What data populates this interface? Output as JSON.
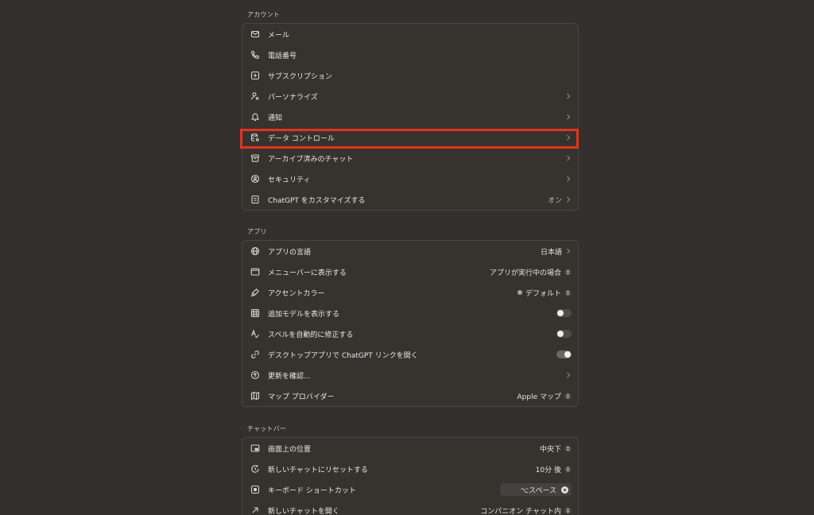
{
  "sections": {
    "account": {
      "title": "アカウント",
      "items": [
        {
          "label": "メール",
          "icon": "mail-icon"
        },
        {
          "label": "電話番号",
          "icon": "phone-icon"
        },
        {
          "label": "サブスクリプション",
          "icon": "plus-square-icon"
        },
        {
          "label": "パーソナライズ",
          "icon": "person-settings-icon"
        },
        {
          "label": "通知",
          "icon": "bell-icon"
        },
        {
          "label": "データ コントロール",
          "icon": "database-settings-icon"
        },
        {
          "label": "アーカイブ済みのチャット",
          "icon": "archive-icon"
        },
        {
          "label": "セキュリティ",
          "icon": "shield-user-icon"
        },
        {
          "label": "ChatGPT をカスタマイズする",
          "icon": "customize-icon",
          "value": "オン"
        }
      ]
    },
    "app": {
      "title": "アプリ",
      "items": [
        {
          "label": "アプリの言語",
          "icon": "globe-icon",
          "value": "日本語"
        },
        {
          "label": "メニューバーに表示する",
          "icon": "window-icon",
          "value": "アプリが実行中の場合"
        },
        {
          "label": "アクセントカラー",
          "icon": "paint-icon",
          "value": "デフォルト"
        },
        {
          "label": "追加モデルを表示する",
          "icon": "models-icon",
          "toggle": false
        },
        {
          "label": "スペルを自動的に修正する",
          "icon": "spellcheck-icon",
          "toggle": false
        },
        {
          "label": "デスクトップアプリで ChatGPT リンクを開く",
          "icon": "link-icon",
          "toggle": true
        },
        {
          "label": "更新を確認...",
          "icon": "update-icon"
        },
        {
          "label": "マップ プロバイダー",
          "icon": "map-icon",
          "value": "Apple マップ"
        }
      ]
    },
    "chatbar": {
      "title": "チャットバー",
      "items": [
        {
          "label": "画面上の位置",
          "icon": "position-icon",
          "value": "中央下"
        },
        {
          "label": "新しいチャットにリセットする",
          "icon": "reset-icon",
          "value": "10分 後"
        },
        {
          "label": "キーボード ショートカット",
          "icon": "keyboard-icon",
          "value": "⌥スペース"
        },
        {
          "label": "新しいチャットを開く",
          "icon": "open-chat-icon",
          "value": "コンパニオン チャット内"
        }
      ]
    }
  },
  "colors": {
    "background": "#33302e",
    "card": "#36332f",
    "highlight": "#e5321e"
  }
}
